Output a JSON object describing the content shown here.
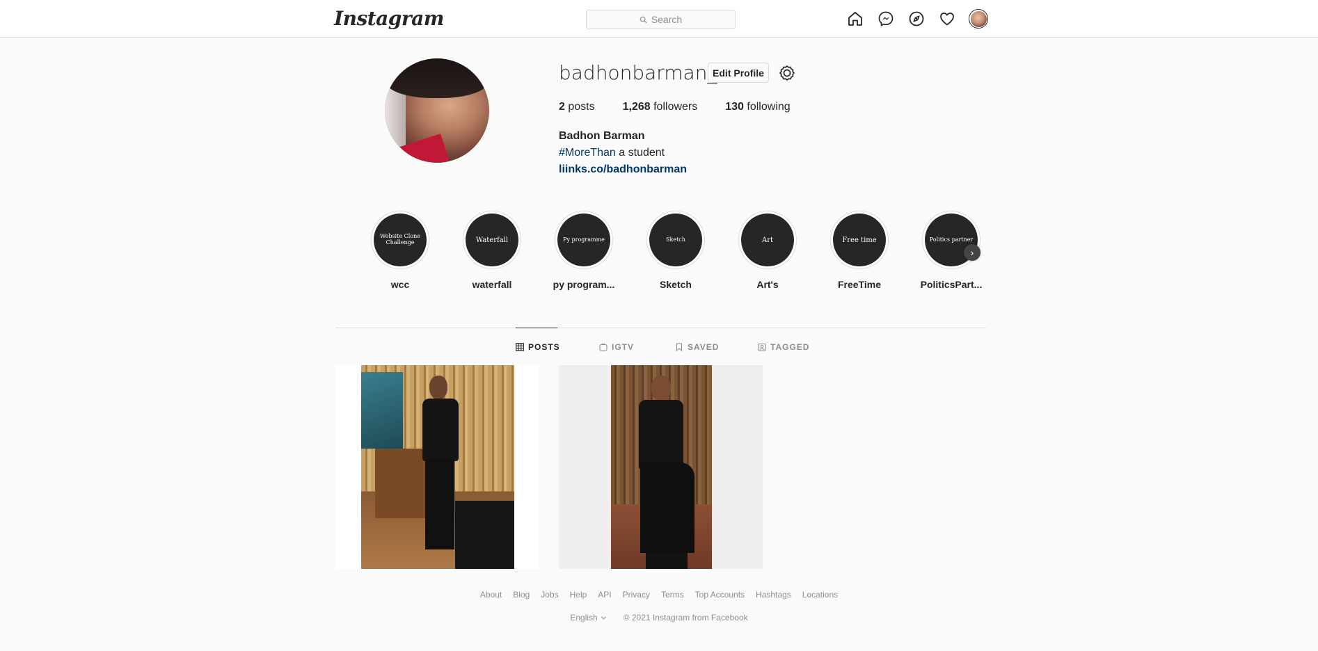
{
  "header": {
    "logo": "Instagram",
    "search_placeholder": "Search",
    "icons": [
      "home-icon",
      "messenger-icon",
      "explore-icon",
      "activity-heart-icon",
      "profile-avatar"
    ]
  },
  "profile": {
    "username": "badhonbarman_",
    "edit_label": "Edit Profile",
    "stats": {
      "posts_count": "2",
      "posts_label": "posts",
      "followers_count": "1,268",
      "followers_label": "followers",
      "following_count": "130",
      "following_label": "following"
    },
    "full_name": "Badhon Barman",
    "bio_tag": "#MoreThan",
    "bio_rest": "a student",
    "link": "liinks.co/badhonbarman"
  },
  "highlights": [
    {
      "cover": "Website Clone Challenge",
      "label": "wcc"
    },
    {
      "cover": "Waterfall",
      "label": "waterfall"
    },
    {
      "cover": "Py programme",
      "label": "py program..."
    },
    {
      "cover": "Sketch",
      "label": "Sketch"
    },
    {
      "cover": "Art",
      "label": "Art's"
    },
    {
      "cover": "Free time",
      "label": "FreeTime"
    },
    {
      "cover": "Politics partner",
      "label": "PoliticsPart..."
    }
  ],
  "tabs": [
    {
      "label": "POSTS",
      "active": true
    },
    {
      "label": "IGTV",
      "active": false
    },
    {
      "label": "SAVED",
      "active": false
    },
    {
      "label": "TAGGED",
      "active": false
    }
  ],
  "footer": {
    "links": [
      "About",
      "Blog",
      "Jobs",
      "Help",
      "API",
      "Privacy",
      "Terms",
      "Top Accounts",
      "Hashtags",
      "Locations"
    ],
    "language": "English",
    "copyright": "© 2021 Instagram from Facebook"
  },
  "colors": {
    "link_blue": "#00376b",
    "text": "#262626",
    "muted": "#8e8e8e",
    "border": "#dbdbdb"
  }
}
